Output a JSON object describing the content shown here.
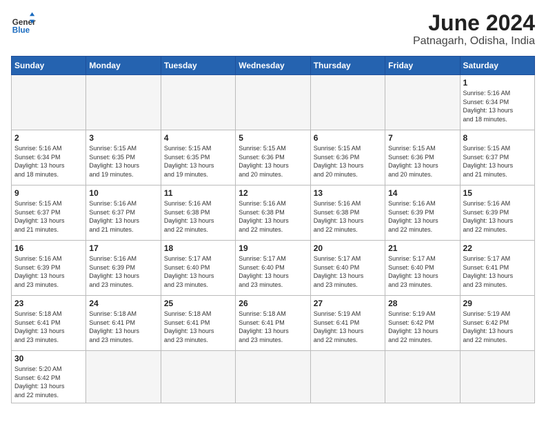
{
  "header": {
    "logo_general": "General",
    "logo_blue": "Blue",
    "title": "June 2024",
    "subtitle": "Patnagarh, Odisha, India"
  },
  "weekdays": [
    "Sunday",
    "Monday",
    "Tuesday",
    "Wednesday",
    "Thursday",
    "Friday",
    "Saturday"
  ],
  "weeks": [
    [
      {
        "day": "",
        "info": ""
      },
      {
        "day": "",
        "info": ""
      },
      {
        "day": "",
        "info": ""
      },
      {
        "day": "",
        "info": ""
      },
      {
        "day": "",
        "info": ""
      },
      {
        "day": "",
        "info": ""
      },
      {
        "day": "1",
        "info": "Sunrise: 5:16 AM\nSunset: 6:34 PM\nDaylight: 13 hours\nand 18 minutes."
      }
    ],
    [
      {
        "day": "2",
        "info": "Sunrise: 5:16 AM\nSunset: 6:34 PM\nDaylight: 13 hours\nand 18 minutes."
      },
      {
        "day": "3",
        "info": "Sunrise: 5:15 AM\nSunset: 6:35 PM\nDaylight: 13 hours\nand 19 minutes."
      },
      {
        "day": "4",
        "info": "Sunrise: 5:15 AM\nSunset: 6:35 PM\nDaylight: 13 hours\nand 19 minutes."
      },
      {
        "day": "5",
        "info": "Sunrise: 5:15 AM\nSunset: 6:36 PM\nDaylight: 13 hours\nand 20 minutes."
      },
      {
        "day": "6",
        "info": "Sunrise: 5:15 AM\nSunset: 6:36 PM\nDaylight: 13 hours\nand 20 minutes."
      },
      {
        "day": "7",
        "info": "Sunrise: 5:15 AM\nSunset: 6:36 PM\nDaylight: 13 hours\nand 20 minutes."
      },
      {
        "day": "8",
        "info": "Sunrise: 5:15 AM\nSunset: 6:37 PM\nDaylight: 13 hours\nand 21 minutes."
      }
    ],
    [
      {
        "day": "9",
        "info": "Sunrise: 5:15 AM\nSunset: 6:37 PM\nDaylight: 13 hours\nand 21 minutes."
      },
      {
        "day": "10",
        "info": "Sunrise: 5:16 AM\nSunset: 6:37 PM\nDaylight: 13 hours\nand 21 minutes."
      },
      {
        "day": "11",
        "info": "Sunrise: 5:16 AM\nSunset: 6:38 PM\nDaylight: 13 hours\nand 22 minutes."
      },
      {
        "day": "12",
        "info": "Sunrise: 5:16 AM\nSunset: 6:38 PM\nDaylight: 13 hours\nand 22 minutes."
      },
      {
        "day": "13",
        "info": "Sunrise: 5:16 AM\nSunset: 6:38 PM\nDaylight: 13 hours\nand 22 minutes."
      },
      {
        "day": "14",
        "info": "Sunrise: 5:16 AM\nSunset: 6:39 PM\nDaylight: 13 hours\nand 22 minutes."
      },
      {
        "day": "15",
        "info": "Sunrise: 5:16 AM\nSunset: 6:39 PM\nDaylight: 13 hours\nand 22 minutes."
      }
    ],
    [
      {
        "day": "16",
        "info": "Sunrise: 5:16 AM\nSunset: 6:39 PM\nDaylight: 13 hours\nand 23 minutes."
      },
      {
        "day": "17",
        "info": "Sunrise: 5:16 AM\nSunset: 6:39 PM\nDaylight: 13 hours\nand 23 minutes."
      },
      {
        "day": "18",
        "info": "Sunrise: 5:17 AM\nSunset: 6:40 PM\nDaylight: 13 hours\nand 23 minutes."
      },
      {
        "day": "19",
        "info": "Sunrise: 5:17 AM\nSunset: 6:40 PM\nDaylight: 13 hours\nand 23 minutes."
      },
      {
        "day": "20",
        "info": "Sunrise: 5:17 AM\nSunset: 6:40 PM\nDaylight: 13 hours\nand 23 minutes."
      },
      {
        "day": "21",
        "info": "Sunrise: 5:17 AM\nSunset: 6:40 PM\nDaylight: 13 hours\nand 23 minutes."
      },
      {
        "day": "22",
        "info": "Sunrise: 5:17 AM\nSunset: 6:41 PM\nDaylight: 13 hours\nand 23 minutes."
      }
    ],
    [
      {
        "day": "23",
        "info": "Sunrise: 5:18 AM\nSunset: 6:41 PM\nDaylight: 13 hours\nand 23 minutes."
      },
      {
        "day": "24",
        "info": "Sunrise: 5:18 AM\nSunset: 6:41 PM\nDaylight: 13 hours\nand 23 minutes."
      },
      {
        "day": "25",
        "info": "Sunrise: 5:18 AM\nSunset: 6:41 PM\nDaylight: 13 hours\nand 23 minutes."
      },
      {
        "day": "26",
        "info": "Sunrise: 5:18 AM\nSunset: 6:41 PM\nDaylight: 13 hours\nand 23 minutes."
      },
      {
        "day": "27",
        "info": "Sunrise: 5:19 AM\nSunset: 6:41 PM\nDaylight: 13 hours\nand 22 minutes."
      },
      {
        "day": "28",
        "info": "Sunrise: 5:19 AM\nSunset: 6:42 PM\nDaylight: 13 hours\nand 22 minutes."
      },
      {
        "day": "29",
        "info": "Sunrise: 5:19 AM\nSunset: 6:42 PM\nDaylight: 13 hours\nand 22 minutes."
      }
    ],
    [
      {
        "day": "30",
        "info": "Sunrise: 5:20 AM\nSunset: 6:42 PM\nDaylight: 13 hours\nand 22 minutes."
      },
      {
        "day": "",
        "info": ""
      },
      {
        "day": "",
        "info": ""
      },
      {
        "day": "",
        "info": ""
      },
      {
        "day": "",
        "info": ""
      },
      {
        "day": "",
        "info": ""
      },
      {
        "day": "",
        "info": ""
      }
    ]
  ]
}
